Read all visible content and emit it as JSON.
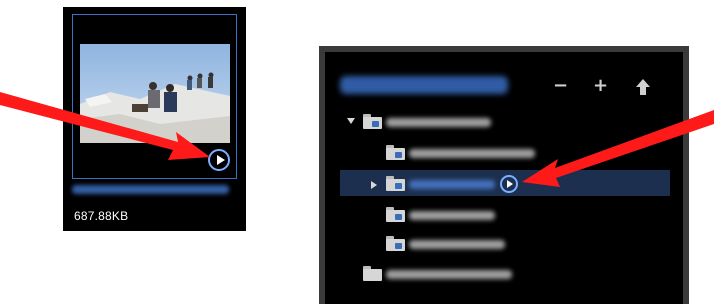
{
  "thumbnail": {
    "file_size": "687.88KB",
    "play_icon": "play-circle-icon"
  },
  "media_sources_panel": {
    "header_buttons": [
      {
        "name": "remove",
        "glyph": "−"
      },
      {
        "name": "add",
        "glyph": "+"
      },
      {
        "name": "up",
        "glyph": "up-arrow-icon"
      }
    ],
    "tree_items": [
      {
        "level": 0,
        "expanded": true
      },
      {
        "level": 1
      },
      {
        "level": 1,
        "selected": true,
        "collapsed": true,
        "play_icon": "play-circle-icon"
      },
      {
        "level": 1
      },
      {
        "level": 1
      },
      {
        "level": 0
      }
    ]
  },
  "annotation": {
    "arrow_color": "#ff1a1a"
  },
  "colors": {
    "accent_blue": "#7ab0ff",
    "selection": "#1c2f4e",
    "panel_bg": "#000000"
  }
}
